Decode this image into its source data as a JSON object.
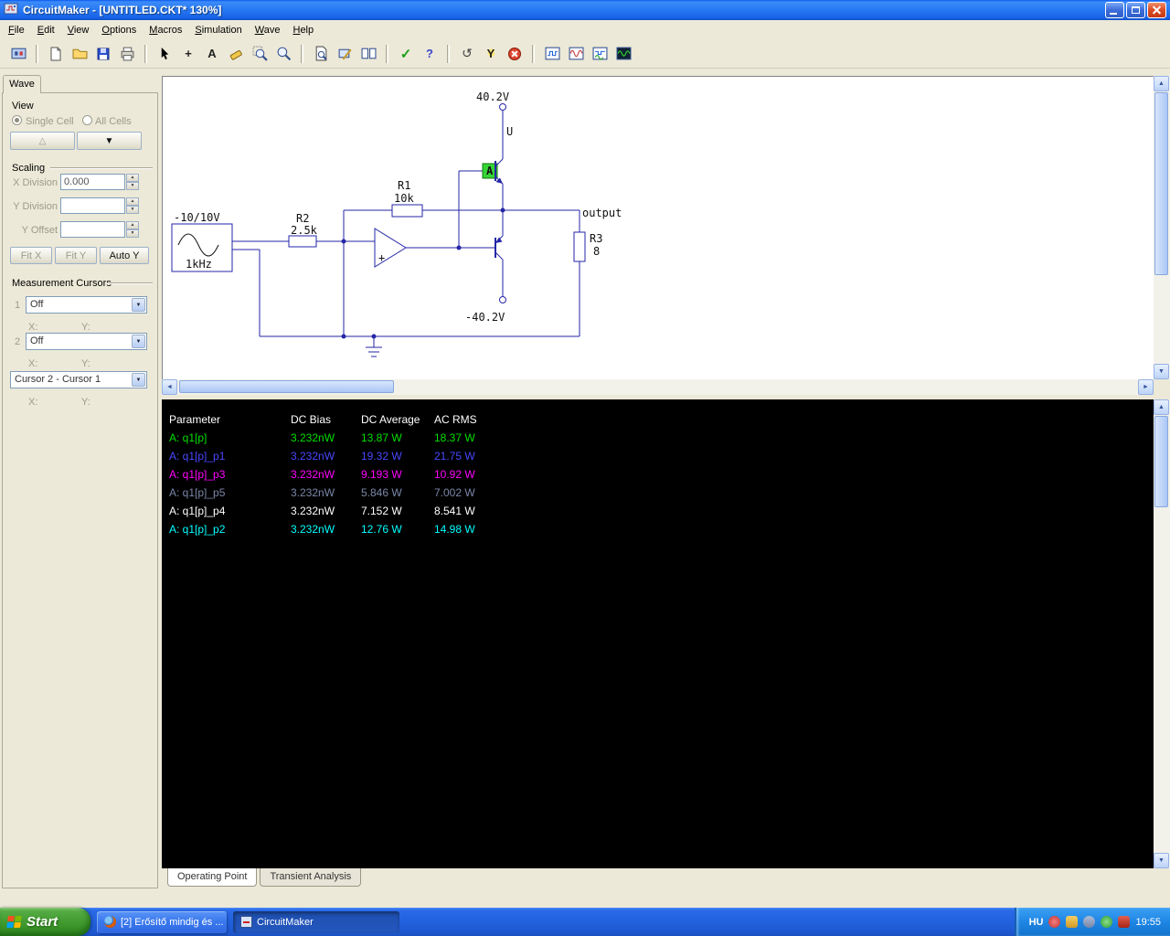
{
  "window": {
    "title": "CircuitMaker - [UNTITLED.CKT* 130%]"
  },
  "menu": {
    "items": [
      "File",
      "Edit",
      "View",
      "Options",
      "Macros",
      "Simulation",
      "Wave",
      "Help"
    ]
  },
  "icons": {
    "up": "▲",
    "down": "▼",
    "left": "◄",
    "right": "►"
  },
  "toolbar": {
    "icons": [
      {
        "name": "parts-bin-icon"
      },
      {
        "name": "new-file-icon"
      },
      {
        "name": "open-file-icon"
      },
      {
        "name": "save-file-icon"
      },
      {
        "name": "print-icon"
      },
      {
        "name": "arrow-tool-icon"
      },
      {
        "name": "wire-tool-icon",
        "glyph": "+"
      },
      {
        "name": "text-tool-icon",
        "glyph": "A"
      },
      {
        "name": "delete-tool-icon"
      },
      {
        "name": "zoom-select-icon"
      },
      {
        "name": "zoom-tool-icon"
      },
      {
        "name": "search-part-icon"
      },
      {
        "name": "model-edit-icon"
      },
      {
        "name": "split-view-icon"
      },
      {
        "name": "run-simulation-icon",
        "glyph": "✓"
      },
      {
        "name": "help-tool-icon",
        "glyph": "?"
      },
      {
        "name": "reset-icon",
        "glyph": "↺"
      },
      {
        "name": "probe-tool-icon",
        "glyph": "Y"
      },
      {
        "name": "stop-simulation-icon"
      },
      {
        "name": "digital-waveform-icon"
      },
      {
        "name": "analog-waveform-icon"
      },
      {
        "name": "mixed-signal-icon"
      },
      {
        "name": "oscilloscope-icon"
      }
    ]
  },
  "sidebar": {
    "tab": "Wave",
    "view_label": "View",
    "single_cell": "Single Cell",
    "all_cells": "All Cells",
    "up_glyph": "△",
    "down_glyph": "▼",
    "scaling_label": "Scaling",
    "x_division_label": "X Division",
    "x_division_value": "0.000",
    "y_division_label": "Y Division",
    "y_division_value": "",
    "y_offset_label": "Y Offset",
    "y_offset_value": "",
    "fit_x": "Fit X",
    "fit_y": "Fit Y",
    "auto_y": "Auto Y",
    "cursors_label": "Measurement Cursors",
    "cursor1_label": "1",
    "cursor1_value": "Off",
    "cursor2_label": "2",
    "cursor2_value": "Off",
    "cursor_diff_value": "Cursor 2 - Cursor 1",
    "x_label": "X:",
    "y_label": "Y:"
  },
  "circuit": {
    "supply_pos": "40.2V",
    "supply_neg": "-40.2V",
    "net_label_u": "U",
    "output_label": "output",
    "probe_label": "A",
    "opamp_plus": "+",
    "r1_name": "R1",
    "r1_value": "10k",
    "r2_name": "R2",
    "r2_value": "2.5k",
    "r3_name": "R3",
    "r3_value": "8",
    "source_range": "-10/10V",
    "source_freq": "1kHz"
  },
  "results": {
    "columns": [
      "Parameter",
      "DC Bias",
      "DC Average",
      "AC RMS"
    ],
    "rows": [
      {
        "name": "A: q1[p]",
        "color": "#00e000",
        "dc_bias": "3.232nW",
        "dc_average": "13.87 W",
        "ac_rms": "18.37 W"
      },
      {
        "name": "A: q1[p]_p1",
        "color": "#4848ff",
        "dc_bias": "3.232nW",
        "dc_average": "19.32 W",
        "ac_rms": "21.75 W"
      },
      {
        "name": "A: q1[p]_p3",
        "color": "#ff00ff",
        "dc_bias": "3.232nW",
        "dc_average": "9.193 W",
        "ac_rms": "10.92 W"
      },
      {
        "name": "A: q1[p]_p5",
        "color": "#7a87a8",
        "dc_bias": "3.232nW",
        "dc_average": "5.846 W",
        "ac_rms": "7.002 W"
      },
      {
        "name": "A: q1[p]_p4",
        "color": "#ffffff",
        "dc_bias": "3.232nW",
        "dc_average": "7.152 W",
        "ac_rms": "8.541 W"
      },
      {
        "name": "A: q1[p]_p2",
        "color": "#00ffff",
        "dc_bias": "3.232nW",
        "dc_average": "12.76 W",
        "ac_rms": "14.98 W"
      }
    ],
    "tabs": [
      {
        "label": "Operating Point"
      },
      {
        "label": "Transient Analysis"
      }
    ]
  },
  "taskbar": {
    "start": "Start",
    "tasks": [
      {
        "label": "[2] Erősítő mindig és ..."
      },
      {
        "label": "CircuitMaker"
      }
    ],
    "tray": {
      "language": "HU",
      "clock": "19:55"
    }
  }
}
